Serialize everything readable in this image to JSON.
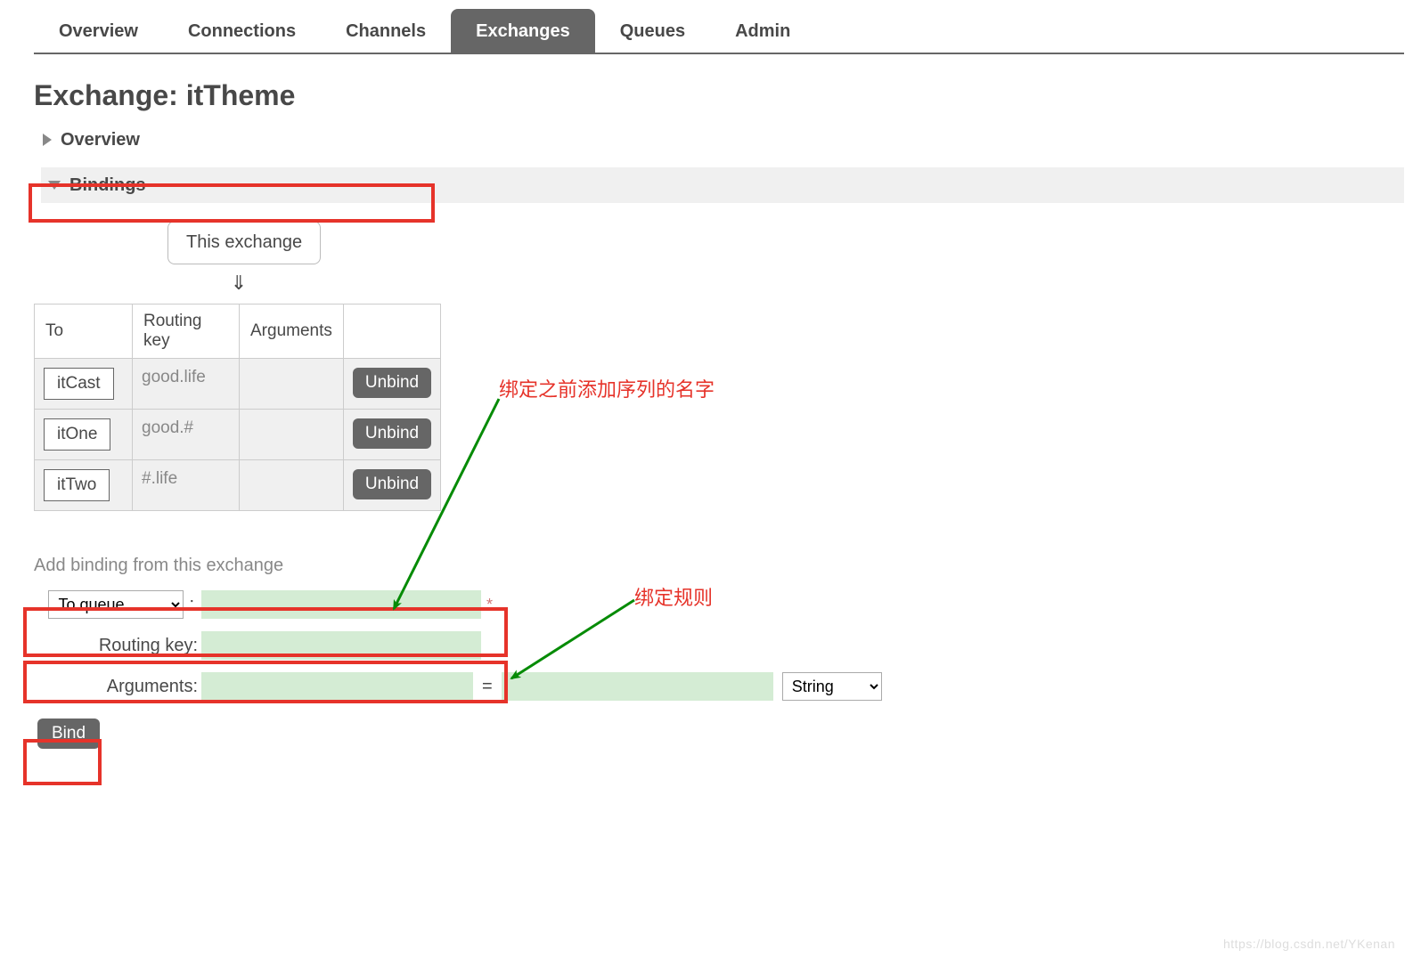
{
  "tabs": {
    "items": [
      {
        "label": "Overview"
      },
      {
        "label": "Connections"
      },
      {
        "label": "Channels"
      },
      {
        "label": "Exchanges"
      },
      {
        "label": "Queues"
      },
      {
        "label": "Admin"
      }
    ],
    "active_index": 3
  },
  "title": {
    "kind": "Exchange:",
    "name": "itTheme"
  },
  "sections": {
    "overview": "Overview",
    "bindings": "Bindings"
  },
  "bindings": {
    "this_exchange_label": "This exchange",
    "down_arrow": "⇓",
    "headers": {
      "to": "To",
      "routing_key": "Routing key",
      "arguments": "Arguments"
    },
    "rows": [
      {
        "to": "itCast",
        "routing_key": "good.life",
        "arguments": "",
        "unbind": "Unbind"
      },
      {
        "to": "itOne",
        "routing_key": "good.#",
        "arguments": "",
        "unbind": "Unbind"
      },
      {
        "to": "itTwo",
        "routing_key": "#.life",
        "arguments": "",
        "unbind": "Unbind"
      }
    ]
  },
  "add_binding": {
    "title": "Add binding from this exchange",
    "to_select": "To queue",
    "routing_key_label": "Routing key:",
    "arguments_label": "Arguments:",
    "type_select": "String",
    "required_mark": "*",
    "equals": "=",
    "bind_button": "Bind"
  },
  "annotations": {
    "queue_name_hint": "绑定之前添加序列的名字",
    "routing_rule_hint": "绑定规则"
  },
  "watermark": "https://blog.csdn.net/YKenan"
}
